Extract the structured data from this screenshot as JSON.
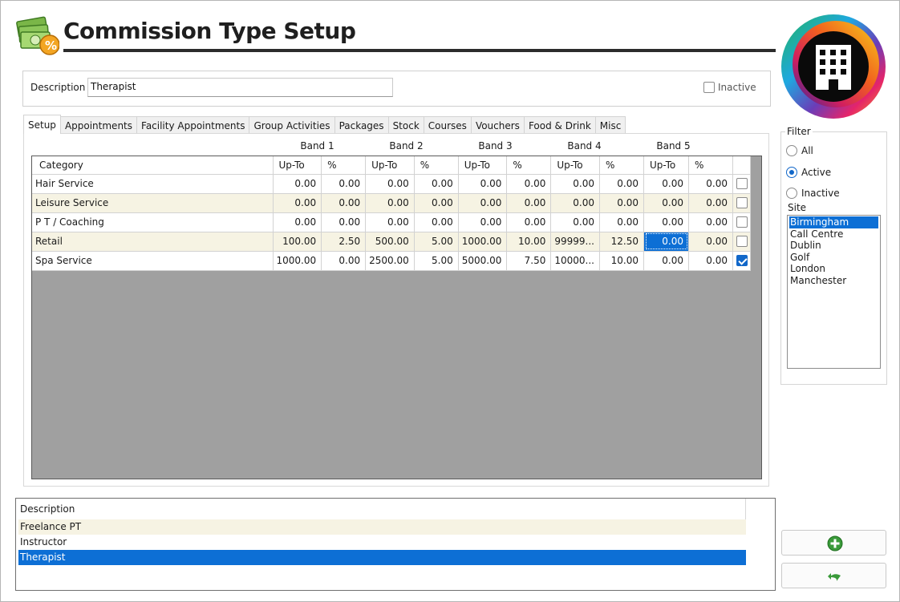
{
  "header": {
    "title": "Commission Type Setup",
    "app_icon": "money-percent-icon",
    "logo": "building-logo-icon"
  },
  "description": {
    "label": "Description",
    "value": "Therapist",
    "inactive_label": "Inactive",
    "inactive_checked": false
  },
  "tabs": [
    {
      "label": "Setup",
      "active": true
    },
    {
      "label": "Appointments"
    },
    {
      "label": "Facility Appointments"
    },
    {
      "label": "Group Activities"
    },
    {
      "label": "Packages"
    },
    {
      "label": "Stock"
    },
    {
      "label": "Courses"
    },
    {
      "label": "Vouchers"
    },
    {
      "label": "Food & Drink"
    },
    {
      "label": "Misc"
    }
  ],
  "grid": {
    "bands": [
      "Band 1",
      "Band 2",
      "Band 3",
      "Band 4",
      "Band 5"
    ],
    "columns": [
      "Category",
      "Up-To",
      "%",
      "Up-To",
      "%",
      "Up-To",
      "%",
      "Up-To",
      "%",
      "Up-To",
      "%"
    ],
    "rows": [
      {
        "category": "Hair Service",
        "values": [
          "0.00",
          "0.00",
          "0.00",
          "0.00",
          "0.00",
          "0.00",
          "0.00",
          "0.00",
          "0.00",
          "0.00"
        ],
        "checked": false
      },
      {
        "category": "Leisure Service",
        "values": [
          "0.00",
          "0.00",
          "0.00",
          "0.00",
          "0.00",
          "0.00",
          "0.00",
          "0.00",
          "0.00",
          "0.00"
        ],
        "checked": false
      },
      {
        "category": "P T / Coaching",
        "values": [
          "0.00",
          "0.00",
          "0.00",
          "0.00",
          "0.00",
          "0.00",
          "0.00",
          "0.00",
          "0.00",
          "0.00"
        ],
        "checked": false
      },
      {
        "category": "Retail",
        "values": [
          "100.00",
          "2.50",
          "500.00",
          "5.00",
          "1000.00",
          "10.00",
          "99999...",
          "12.50",
          "0.00",
          "0.00"
        ],
        "checked": false
      },
      {
        "category": "Spa Service",
        "values": [
          "1000.00",
          "0.00",
          "2500.00",
          "5.00",
          "5000.00",
          "7.50",
          "10000...",
          "10.00",
          "0.00",
          "0.00"
        ],
        "checked": true
      }
    ]
  },
  "filter": {
    "title": "Filter",
    "options": [
      "All",
      "Active",
      "Inactive"
    ],
    "selected": "Active",
    "site_label": "Site",
    "sites": [
      "Birmingham",
      "Call Centre",
      "Dublin",
      "Golf",
      "London",
      "Manchester"
    ],
    "selected_site": "Birmingham"
  },
  "list": {
    "header": "Description",
    "items": [
      "Freelance PT",
      "Instructor",
      "Therapist"
    ],
    "selected": "Therapist"
  },
  "buttons": {
    "add_icon": "plus-circle-icon",
    "undo_icon": "undo-arrow-icon",
    "add_color": "#3a9a3a",
    "undo_color": "#3a9a3a"
  },
  "colors": {
    "selection": "#0d6fd5",
    "alt_row": "#f6f3e3",
    "grid_empty": "#a0a0a0"
  }
}
